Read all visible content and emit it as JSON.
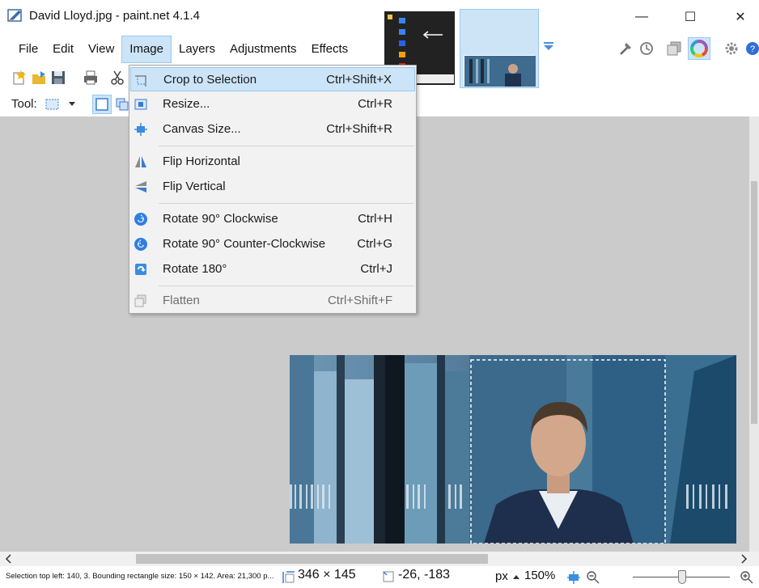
{
  "window": {
    "title": "David Lloyd.jpg - paint.net 4.1.4",
    "minimize": "—",
    "maximize": "☐",
    "close": "✕"
  },
  "menu": {
    "file": "File",
    "edit": "Edit",
    "view": "View",
    "image": "Image",
    "layers": "Layers",
    "adjustments": "Adjustments",
    "effects": "Effects"
  },
  "toolbar": {
    "tool_label": "Tool:"
  },
  "image_menu": {
    "items": [
      {
        "label": "Crop to Selection",
        "shortcut": "Ctrl+Shift+X",
        "icon": "crop-icon"
      },
      {
        "label": "Resize...",
        "shortcut": "Ctrl+R",
        "icon": "resize-icon"
      },
      {
        "label": "Canvas Size...",
        "shortcut": "Ctrl+Shift+R",
        "icon": "canvas-size-icon"
      },
      {
        "label": "Flip Horizontal",
        "shortcut": "",
        "icon": "flip-horizontal-icon"
      },
      {
        "label": "Flip Vertical",
        "shortcut": "",
        "icon": "flip-vertical-icon"
      },
      {
        "label": "Rotate 90° Clockwise",
        "shortcut": "Ctrl+H",
        "icon": "rotate-cw-icon"
      },
      {
        "label": "Rotate 90° Counter-Clockwise",
        "shortcut": "Ctrl+G",
        "icon": "rotate-ccw-icon"
      },
      {
        "label": "Rotate 180°",
        "shortcut": "Ctrl+J",
        "icon": "rotate-180-icon"
      },
      {
        "label": "Flatten",
        "shortcut": "Ctrl+Shift+F",
        "icon": "flatten-icon"
      }
    ]
  },
  "status": {
    "selection_info": "Selection top left: 140, 3. Bounding rectangle size: 150 × 142. Area: 21,300 p...",
    "image_size": "346 × 145",
    "cursor_pos": "-26, -183",
    "unit": "px",
    "zoom": "150%"
  },
  "colors": {
    "menu_highlight": "#cce4f7",
    "menu_highlight_border": "#99c9ef",
    "workspace": "#cbcbcb"
  }
}
